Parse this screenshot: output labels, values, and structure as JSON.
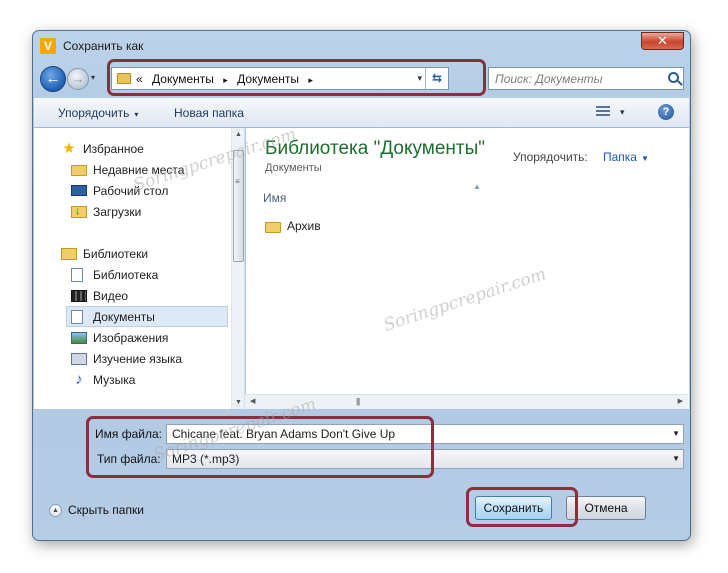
{
  "window": {
    "title": "Сохранить как",
    "close_glyph": "✕",
    "app_icon_letter": "V"
  },
  "navbar": {
    "back_glyph": "←",
    "forward_glyph": "→",
    "address": {
      "prefix": "«",
      "segments": [
        "Документы",
        "Документы"
      ],
      "separator": "▸",
      "dropdown_glyph": "▾",
      "refresh_glyph": "⇆"
    },
    "search_placeholder": "Поиск: Документы"
  },
  "toolbar": {
    "organize_label": "Упорядочить",
    "new_folder_label": "Новая папка",
    "caret": "▾",
    "help_glyph": "?"
  },
  "nav_pane": {
    "favorites": {
      "label": "Избранное",
      "items": [
        {
          "label": "Недавние места",
          "icon": "recent-places-icon"
        },
        {
          "label": "Рабочий стол",
          "icon": "desktop-icon"
        },
        {
          "label": "Загрузки",
          "icon": "downloads-icon"
        }
      ]
    },
    "libraries": {
      "label": "Библиотеки",
      "items": [
        {
          "label": "Библиотека",
          "icon": "library-icon"
        },
        {
          "label": "Видео",
          "icon": "video-icon"
        },
        {
          "label": "Документы",
          "icon": "documents-icon",
          "selected": true
        },
        {
          "label": "Изображения",
          "icon": "images-icon"
        },
        {
          "label": "Изучение языка",
          "icon": "language-icon"
        },
        {
          "label": "Музыка",
          "icon": "music-icon"
        }
      ]
    }
  },
  "main": {
    "library_title": "Библиотека \"Документы\"",
    "library_subtitle": "Документы",
    "arrange_label": "Упорядочить:",
    "arrange_value": "Папка",
    "column_name": "Имя",
    "items": [
      {
        "name": "Архив",
        "type": "folder"
      }
    ]
  },
  "form": {
    "filename_label": "Имя файла:",
    "filename_value": "Chicane feat. Bryan Adams Don't Give Up",
    "filetype_label": "Тип файла:",
    "filetype_value": "MP3 (*.mp3)"
  },
  "footer": {
    "hide_folders_label": "Скрыть папки",
    "save_label": "Сохранить",
    "cancel_label": "Отмена"
  },
  "watermark_text": "Soringpcrepair.com",
  "colors": {
    "highlight": "#8b2e3e",
    "library_title": "#1e6e2f",
    "accent_link": "#1d5aa8"
  }
}
